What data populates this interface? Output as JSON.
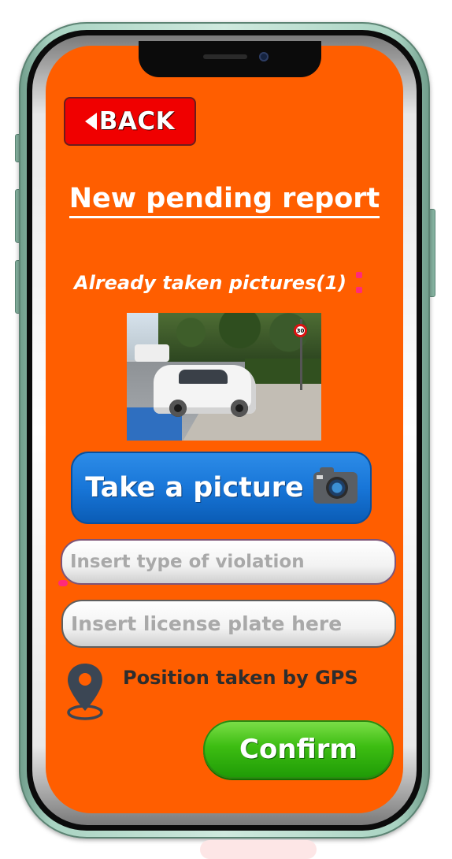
{
  "header": {
    "back_label": "BACK",
    "title": "New pending report"
  },
  "pictures": {
    "label": "Already taken pictures(1)",
    "count": 1,
    "sign_text": "30"
  },
  "actions": {
    "take_picture_label": "Take a picture",
    "confirm_label": "Confirm"
  },
  "form": {
    "violation_placeholder": "Insert type of violation",
    "plate_placeholder": "Insert license plate here"
  },
  "gps": {
    "text": "Position taken by GPS"
  },
  "colors": {
    "background": "#ff5e00",
    "back_button": "#f00000",
    "take_picture_button": "#1876d8",
    "confirm_button": "#3dbd12",
    "phone_frame": "#a9d3c2"
  },
  "icons": [
    "back-arrow-icon",
    "camera-icon",
    "location-pin-icon"
  ]
}
